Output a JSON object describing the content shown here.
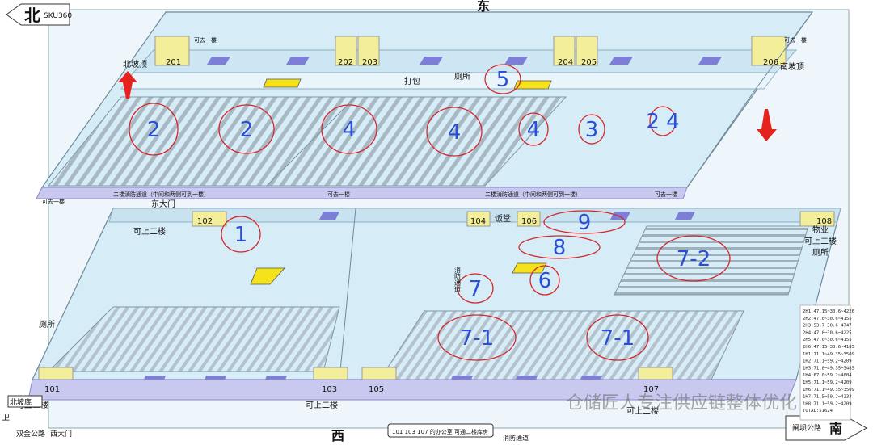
{
  "compass": {
    "north": "北",
    "east": "东",
    "west": "西",
    "south": "南",
    "north_code": "SKU360"
  },
  "upper_floor": {
    "labels": {
      "north_slope_top": "北坡顶",
      "south_slope_top": "南坡顶",
      "packing": "打包",
      "toilet": "厕所",
      "fire_passage_left": "二楼消防通道（中间和两侧可到一楼）",
      "fire_passage_right": "二楼消防通道（中间和两侧可到一楼）",
      "can_go_ground_left": "可去一楼",
      "can_go_ground_mid": "可去一楼",
      "can_go_ground_right": "可去一楼",
      "can_go_ground_top_left": "可去一楼",
      "can_go_ground_top_right": "可去一楼"
    },
    "docks": [
      "201",
      "202",
      "203",
      "204",
      "205",
      "206"
    ],
    "zones": [
      "2",
      "2",
      "4",
      "4",
      "4",
      "3",
      "2 4",
      "5"
    ]
  },
  "ground_floor": {
    "labels": {
      "east_gate": "东大门",
      "can_up_second_left": "可上二楼",
      "canteen": "饭堂",
      "property": "物业",
      "can_up_second_right": "可上二楼",
      "toilet_right": "厕所",
      "toilet_left": "厕所",
      "fire_passage_vertical": "消防通道",
      "can_up_second_bottom_left": "可上二楼",
      "can_up_second_bottom_mid": "可上二楼",
      "can_up_second_bottom_right": "可上二楼",
      "north_slope_bottom": "北坡底",
      "guard": "卫"
    },
    "docks": [
      "101",
      "102",
      "103",
      "104",
      "105",
      "106",
      "107",
      "108"
    ],
    "zones": [
      "1",
      "7",
      "6",
      "8",
      "9",
      "7-1",
      "7-1",
      "7-2"
    ]
  },
  "footer": {
    "double_road": "双金公路",
    "west_gate": "西大门",
    "office_note": "101 103 107 的办公室 可通二楼库房",
    "fire_passage": "消防通道",
    "south_road": "闸坝公路",
    "watermark": "仓储匠人专注供应链整体优化"
  },
  "legend_right": {
    "rows": [
      "2H1:47.15~30.6~4226",
      "2H2:47.0~30.6~4155",
      "2H3:53.7~30.6~4747",
      "2H4:47.8~30.6~4225",
      "2H5:47.0~30.6~4155",
      "2H6:47.15~30.6~4185",
      "1H1:71.1~49.35~3509",
      "1H2:71.1~59.2~4209",
      "1H3:71.8~49.35~3485",
      "1H4:67.0~59.2~4004",
      "1H5:71.1~59.2~4209",
      "1H6:71.1~49.35~3509",
      "1H7:71.5~59.2~4233",
      "1H8:71.1~59.2~4209",
      "TOTAL:51624"
    ]
  },
  "colors": {
    "floor_light": "#d6ecf7",
    "floor_mid": "#bfe2f2",
    "rack_grey": "#a9b9c4",
    "dock_yellow": "#f2ee9a",
    "dock_blue": "#7d7fd6",
    "circle_red": "#d6262a",
    "zone_blue": "#2a4fd6",
    "arrow_red": "#e3231c"
  }
}
